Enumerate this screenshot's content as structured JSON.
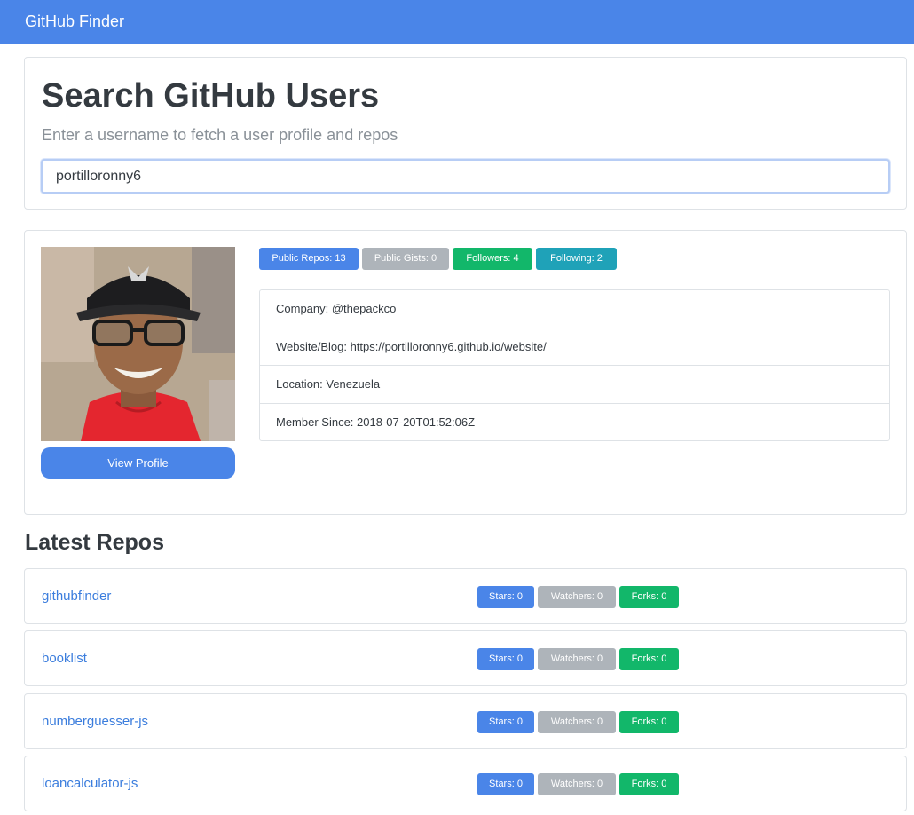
{
  "navbar": {
    "brand": "GitHub Finder"
  },
  "search": {
    "title": "Search GitHub Users",
    "lead": "Enter a username to fetch a user profile and repos",
    "value": "portilloronny6"
  },
  "profile": {
    "view_profile_label": "View Profile",
    "badges": {
      "public_repos": "Public Repos: 13",
      "public_gists": "Public Gists: 0",
      "followers": "Followers: 4",
      "following": "Following: 2"
    },
    "info": {
      "company": "Company: @thepackco",
      "website": "Website/Blog: https://portilloronny6.github.io/website/",
      "location": "Location: Venezuela",
      "member_since": "Member Since: 2018-07-20T01:52:06Z"
    }
  },
  "repos": {
    "heading": "Latest Repos",
    "items": [
      {
        "name": "githubfinder",
        "stars": "Stars: 0",
        "watchers": "Watchers: 0",
        "forks": "Forks: 0"
      },
      {
        "name": "booklist",
        "stars": "Stars: 0",
        "watchers": "Watchers: 0",
        "forks": "Forks: 0"
      },
      {
        "name": "numberguesser-js",
        "stars": "Stars: 0",
        "watchers": "Watchers: 0",
        "forks": "Forks: 0"
      },
      {
        "name": "loancalculator-js",
        "stars": "Stars: 0",
        "watchers": "Watchers: 0",
        "forks": "Forks: 0"
      }
    ]
  },
  "colors": {
    "primary": "#4a85e8",
    "secondary": "#aeb4ba",
    "success": "#12b76a",
    "info": "#1fa2b8",
    "link": "#3b7ddd"
  }
}
